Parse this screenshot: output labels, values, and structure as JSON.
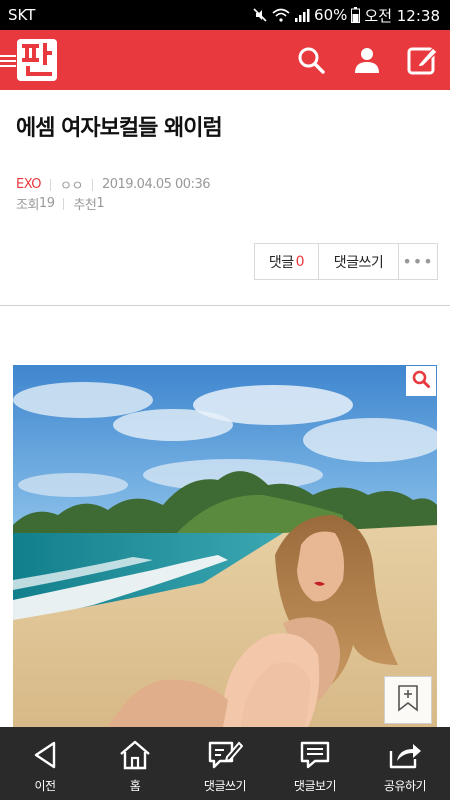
{
  "status_bar": {
    "carrier": "SKT",
    "battery": "60%",
    "time": "오전 12:38"
  },
  "header": {
    "logo_text": "판",
    "icons": [
      "search-icon",
      "user-icon",
      "write-icon"
    ],
    "brand_color": "#e8393f"
  },
  "article": {
    "title": "에셈 여자보컬들 왜이럼",
    "category": "EXO",
    "author": "ㅇㅇ",
    "date": "2019.04.05 00:36",
    "views_label": "조회",
    "views": "19",
    "recommend_label": "추천",
    "recommend": "1"
  },
  "actions": {
    "comments_label": "댓글",
    "comments_count": "0",
    "write_comment_label": "댓글쓰기",
    "more_label": "•••"
  },
  "bottom_nav": {
    "items": [
      {
        "label": "이전",
        "icon": "back-icon"
      },
      {
        "label": "홈",
        "icon": "home-icon"
      },
      {
        "label": "댓글쓰기",
        "icon": "write-comment-icon"
      },
      {
        "label": "댓글보기",
        "icon": "view-comments-icon"
      },
      {
        "label": "공유하기",
        "icon": "share-icon"
      }
    ]
  }
}
